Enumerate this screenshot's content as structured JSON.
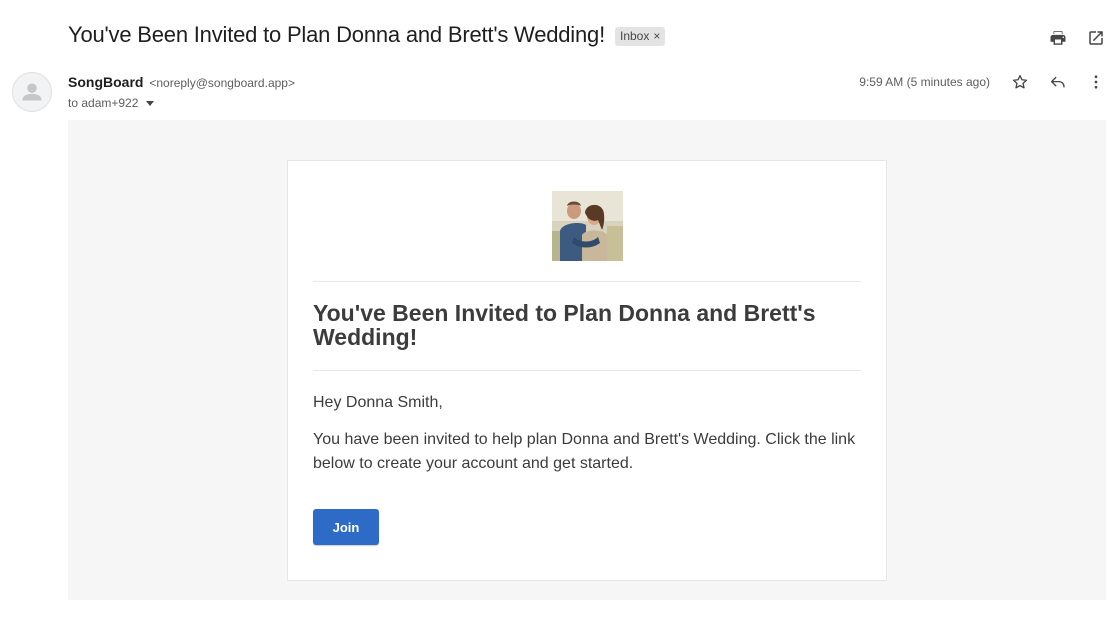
{
  "header": {
    "subject": "You've Been Invited to Plan Donna and Brett's Wedding!",
    "label": "Inbox",
    "label_remove": "×",
    "icons": {
      "print": "print-icon",
      "open_new_window": "open-in-new-window-icon"
    }
  },
  "sender": {
    "name": "SongBoard",
    "email": "<noreply@songboard.app>",
    "to_prefix": "to",
    "to": "adam+922",
    "timestamp": "9:59 AM (5 minutes ago)",
    "icons": {
      "avatar": "person-icon",
      "star": "star-icon",
      "reply": "reply-icon",
      "more": "more-vert-icon",
      "details": "chevron-down-icon"
    }
  },
  "email_body": {
    "title": "You've Been Invited to Plan Donna and Brett's Wedding!",
    "greeting": "Hey Donna Smith,",
    "message": "You have been invited to help plan Donna and Brett's Wedding. Click the link below to create your account and get started.",
    "join_label": "Join",
    "colors": {
      "button": "#2e6bc6",
      "canvas": "#f6f6f6",
      "label_chip": "#e3e3e3"
    }
  }
}
